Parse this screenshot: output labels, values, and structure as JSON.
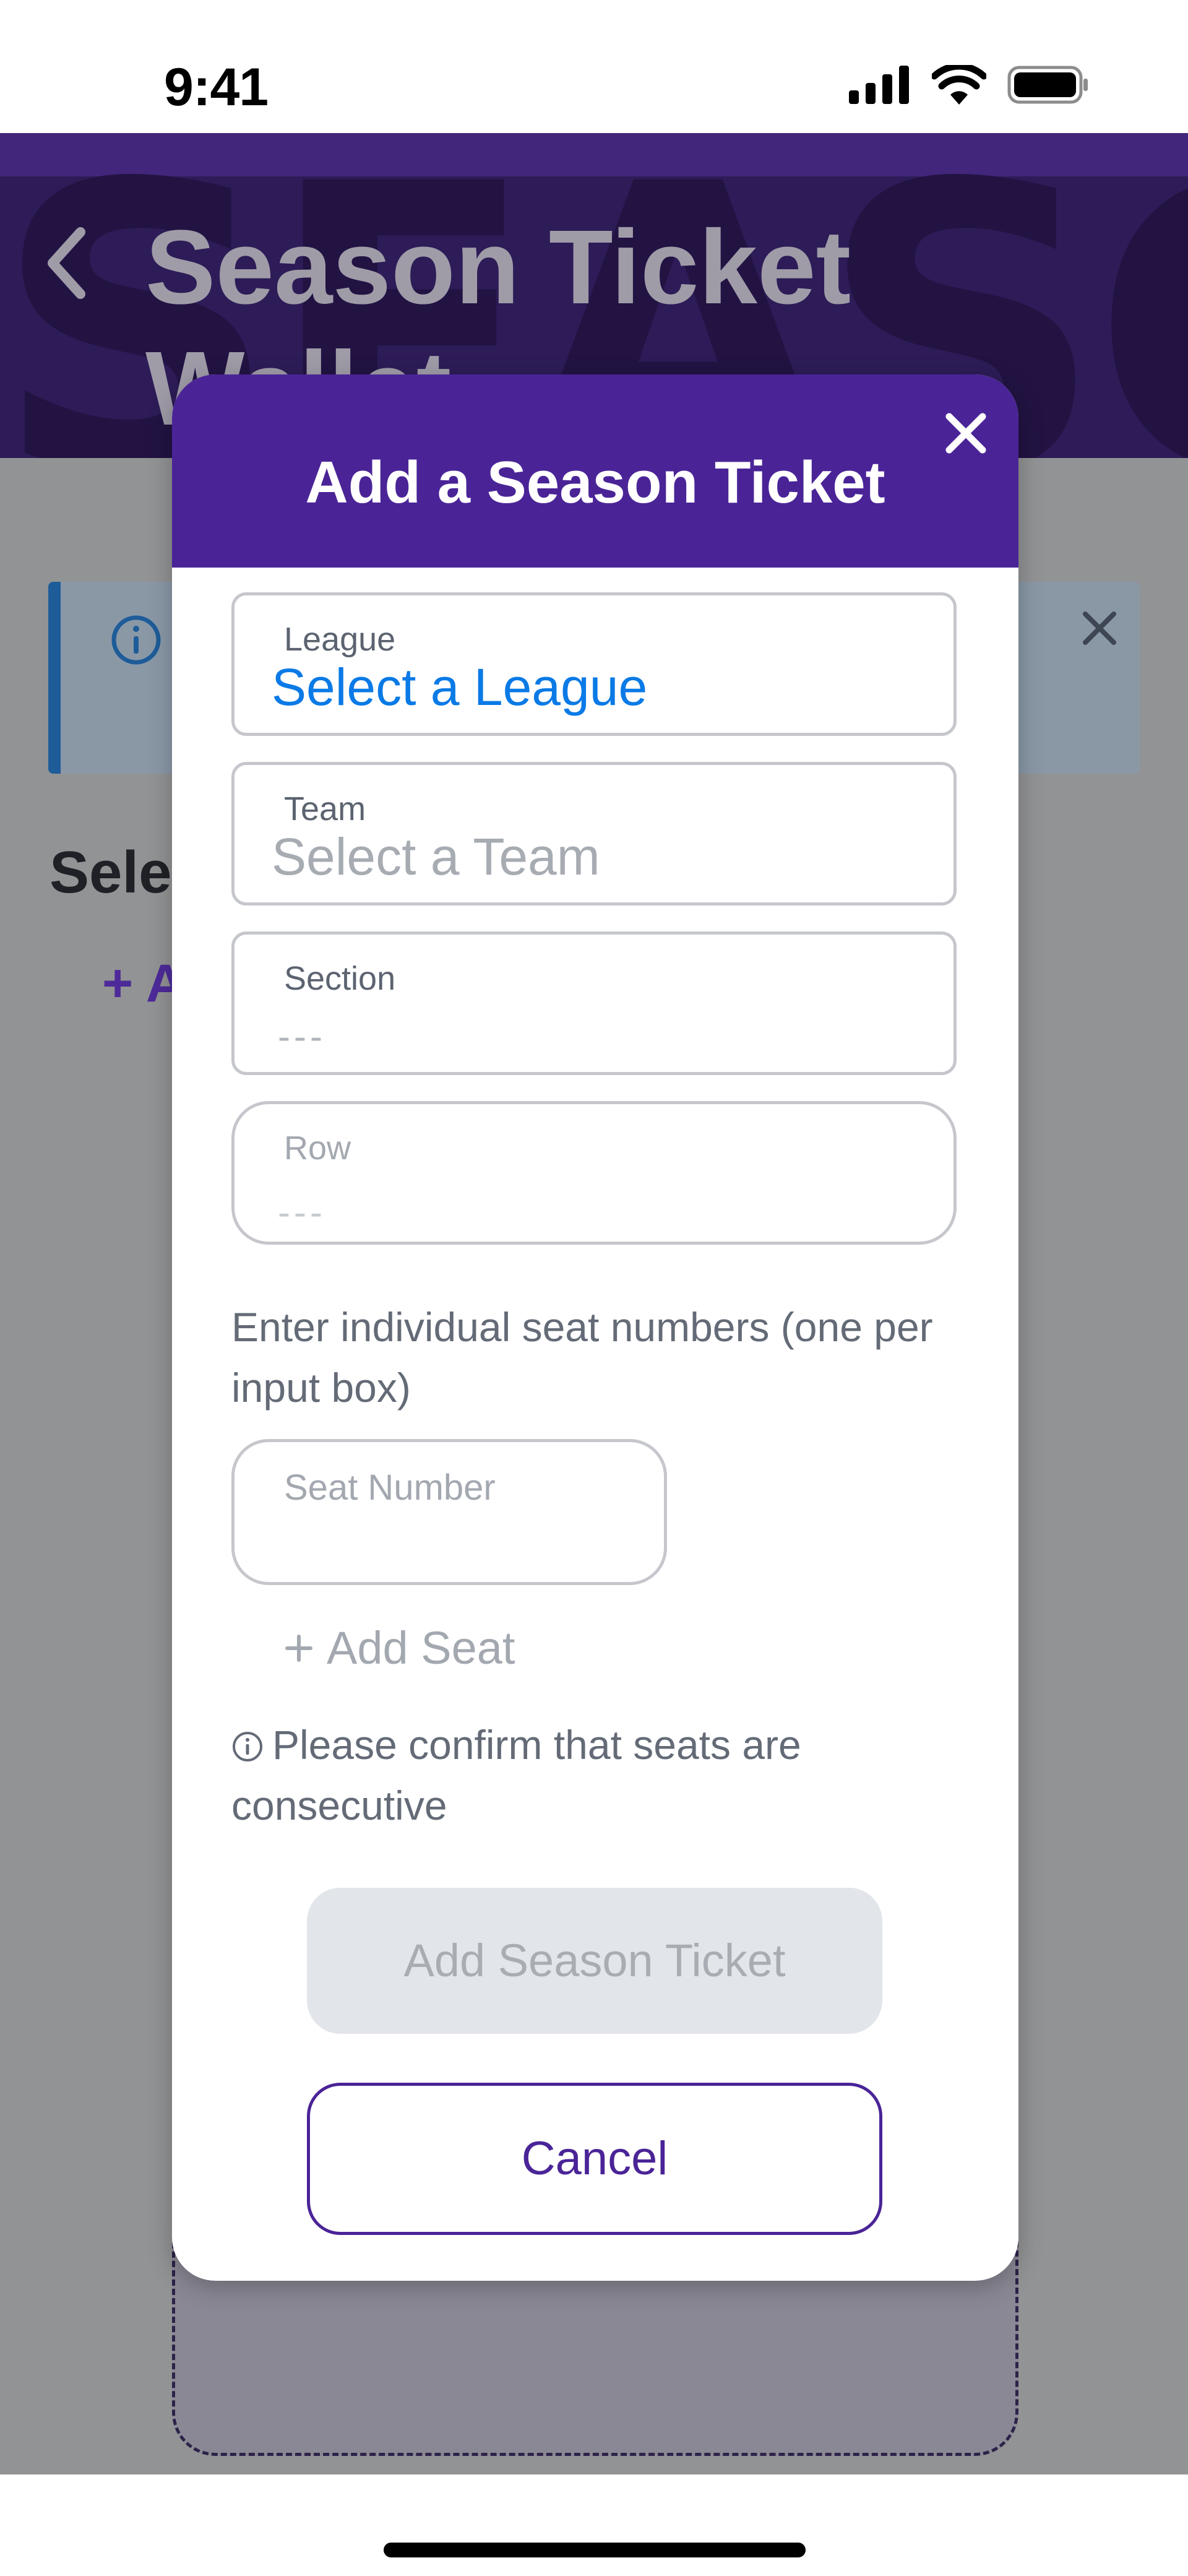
{
  "status_bar": {
    "time": "9:41",
    "icons": [
      "cellular-signal-icon",
      "wifi-icon",
      "battery-icon"
    ]
  },
  "header": {
    "title": "Season Ticket Wallet",
    "watermark": "SEASON T",
    "back_icon": "chevron-left-icon"
  },
  "background": {
    "section_heading": "Sele",
    "add_link": "+ A"
  },
  "modal": {
    "title": "Add a Season Ticket",
    "close_icon": "close-icon",
    "fields": {
      "league": {
        "label": "League",
        "value": "Select a League"
      },
      "team": {
        "label": "Team",
        "value": "Select a Team"
      },
      "section": {
        "label": "Section",
        "value": "---"
      },
      "row": {
        "label": "Row",
        "value": "---"
      }
    },
    "instructions": "Enter individual seat numbers (one per input box)",
    "seat_field": {
      "label": "Seat Number",
      "value": ""
    },
    "add_seat_label": "Add Seat",
    "confirm_note": "Please confirm that seats are consecutive",
    "add_button_label": "Add Season Ticket",
    "cancel_button_label": "Cancel"
  },
  "colors": {
    "brand_purple": "#4a2497",
    "link_blue": "#0a7ae6",
    "disabled_gray": "#e2e5e9",
    "info_blue": "#1e5c99"
  }
}
